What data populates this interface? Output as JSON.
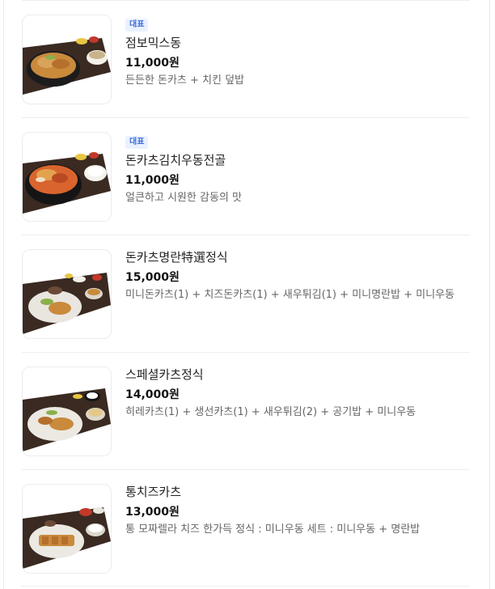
{
  "menu": {
    "items": [
      {
        "badge": "대표",
        "name": "점보믹스동",
        "price": "11,000원",
        "description": "든든한 돈카츠 + 치킨 덮밥",
        "image_icon": "jumbo-mix-bowl-photo"
      },
      {
        "badge": "대표",
        "name": "돈카츠김치우동전골",
        "price": "11,000원",
        "description": "얼큰하고 시원한 감동의 맛",
        "image_icon": "kimchi-udon-hotpot-photo"
      },
      {
        "badge": "",
        "name": "돈카츠명란特選정식",
        "price": "15,000원",
        "description": "미니돈카츠(1) + 치즈돈카츠(1) + 새우튀김(1) + 미니명란밥 + 미니우동",
        "image_icon": "mentaiko-set-photo"
      },
      {
        "badge": "",
        "name": "스페셜카츠정식",
        "price": "14,000원",
        "description": "히레카츠(1) + 생선카츠(1) + 새우튀김(2) + 공기밥 + 미니우동",
        "image_icon": "special-katsu-set-photo"
      },
      {
        "badge": "",
        "name": "통치즈카츠",
        "price": "13,000원",
        "description": "통 모짜렐라 치즈 한가득 정식 : 미니우동 세트 : 미니우동 + 명란밥",
        "image_icon": "cheese-katsu-set-photo"
      }
    ]
  },
  "colors": {
    "badge_text": "#3a6fd8",
    "badge_bg": "#eaf1ff",
    "price": "#111111",
    "description": "#666666"
  }
}
